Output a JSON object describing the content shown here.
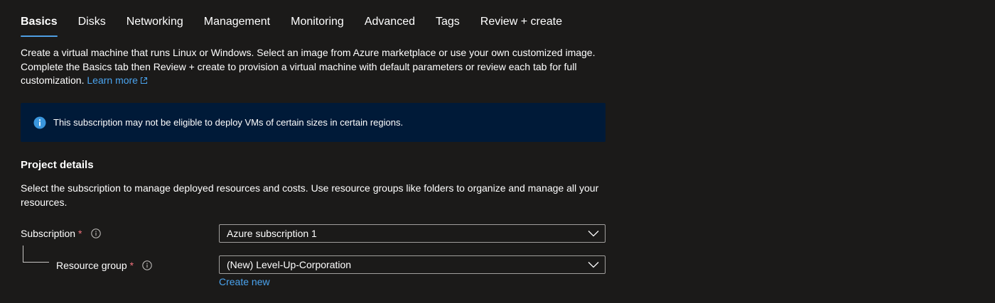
{
  "tabs": [
    {
      "label": "Basics",
      "active": true
    },
    {
      "label": "Disks",
      "active": false
    },
    {
      "label": "Networking",
      "active": false
    },
    {
      "label": "Management",
      "active": false
    },
    {
      "label": "Monitoring",
      "active": false
    },
    {
      "label": "Advanced",
      "active": false
    },
    {
      "label": "Tags",
      "active": false
    },
    {
      "label": "Review + create",
      "active": false
    }
  ],
  "intro": {
    "text": "Create a virtual machine that runs Linux or Windows. Select an image from Azure marketplace or use your own customized image. Complete the Basics tab then Review + create to provision a virtual machine with default parameters or review each tab for full customization.",
    "learn_more": "Learn more"
  },
  "banner": {
    "icon": "info-icon",
    "text": "This subscription may not be eligible to deploy VMs of certain sizes in certain regions."
  },
  "project_details": {
    "title": "Project details",
    "description": "Select the subscription to manage deployed resources and costs. Use resource groups like folders to organize and manage all your resources.",
    "subscription": {
      "label": "Subscription",
      "required_mark": "*",
      "value": "Azure subscription 1"
    },
    "resource_group": {
      "label": "Resource group",
      "required_mark": "*",
      "value": "(New) Level-Up-Corporation",
      "create_new": "Create new"
    }
  },
  "colors": {
    "background": "#1b1a19",
    "accent": "#4f9fe3",
    "link": "#4aa3ee",
    "banner_bg": "#001a38",
    "required": "#f1707b"
  }
}
